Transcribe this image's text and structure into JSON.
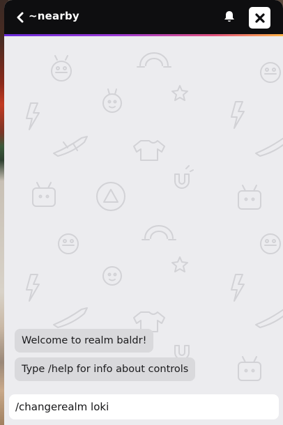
{
  "header": {
    "back_icon": "chevron-left-icon",
    "title": "~nearby",
    "bell_icon": "bell-icon",
    "close_icon": "close-icon"
  },
  "background_pattern": {
    "icons": [
      "robot-icon",
      "rainbow-icon",
      "star-icon",
      "lightning-icon",
      "sweater-icon",
      "magnet-icon",
      "tv-icon",
      "pizza-icon",
      "airplane-icon",
      "planet-icon"
    ]
  },
  "messages": [
    {
      "text": "Welcome to realm baldr!"
    },
    {
      "text": "Type /help for info about controls"
    }
  ],
  "input": {
    "value": "/changerealm loki"
  },
  "colors": {
    "header_bg": "#0e0e10",
    "chat_bg": "#ececef",
    "bubble_bg": "#d9d9dc",
    "accent_start": "#6a2bd9",
    "accent_end": "#ffb347"
  }
}
